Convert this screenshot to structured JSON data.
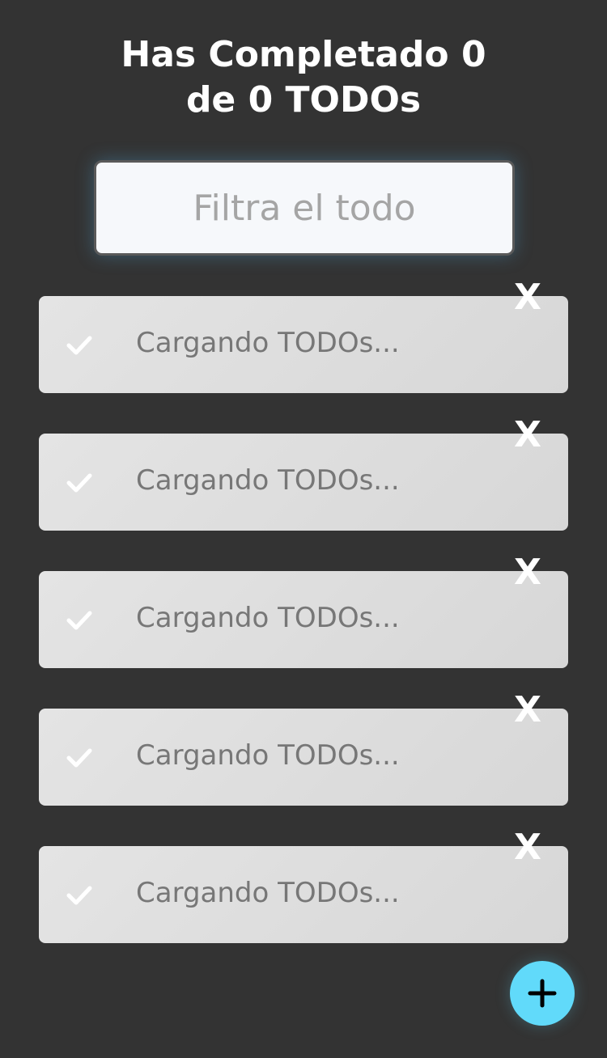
{
  "header": {
    "title_line1": "Has Completado 0",
    "title_line2": "de 0 TODOs"
  },
  "search": {
    "placeholder": "Filtra el todo",
    "value": ""
  },
  "todos": [
    {
      "text": "Cargando TODOs...",
      "delete_label": "X",
      "check_icon": "check-icon"
    },
    {
      "text": "Cargando TODOs...",
      "delete_label": "X",
      "check_icon": "check-icon"
    },
    {
      "text": "Cargando TODOs...",
      "delete_label": "X",
      "check_icon": "check-icon"
    },
    {
      "text": "Cargando TODOs...",
      "delete_label": "X",
      "check_icon": "check-icon"
    },
    {
      "text": "Cargando TODOs...",
      "delete_label": "X",
      "check_icon": "check-icon"
    }
  ],
  "fab": {
    "icon": "plus-icon"
  },
  "colors": {
    "background": "#333333",
    "accent": "#61dafa",
    "card": "#dddddd",
    "muted_text": "#777777"
  }
}
